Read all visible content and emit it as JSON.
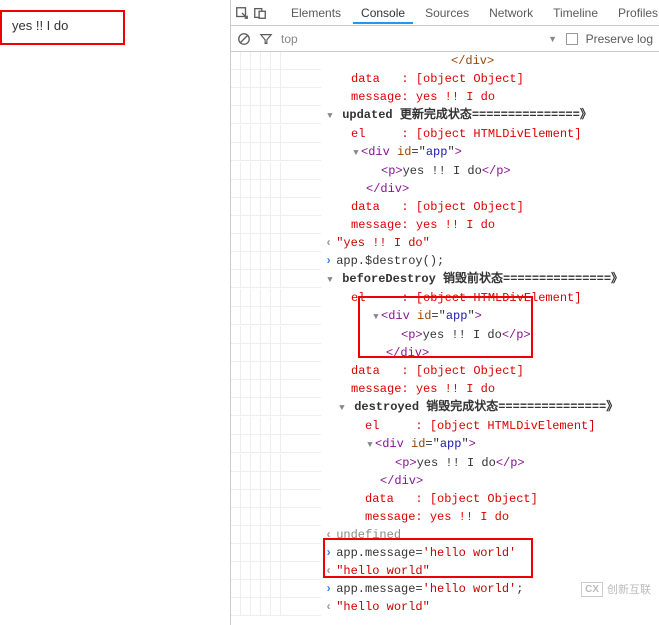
{
  "app_output": "yes !! I do",
  "tabs": {
    "elements": "Elements",
    "console": "Console",
    "sources": "Sources",
    "network": "Network",
    "timeline": "Timeline",
    "profiles": "Profiles"
  },
  "filter": {
    "top": "top",
    "preserve": "Preserve log"
  },
  "log": {
    "close_div": "</div>",
    "data_lbl": "data   : ",
    "data_val": "[object Object]",
    "msg_lbl": "message: ",
    "msg_val": "yes !! I do",
    "updated": "updated 更新完成状态===============》",
    "el_lbl": "el     : ",
    "el_val": "[object HTMLDivElement]",
    "div_open": "<div id=\"app\">",
    "p_line": "<p>yes !! I do</p>",
    "quote_yes": "\"yes !! I do\"",
    "destroy_call": "app.$destroy();",
    "before_destroy": "beforeDestroy 销毁前状态===============》",
    "destroyed": "destroyed 销毁完成状态===============》",
    "undefined": "undefined",
    "set_msg1": "app.message='hello world'",
    "hello_out": "\"hello world\"",
    "set_msg2": "app.message='hello world';",
    "hello_out2": "\"hello world\""
  },
  "watermark": {
    "logo": "CX",
    "text": "创新互联"
  }
}
